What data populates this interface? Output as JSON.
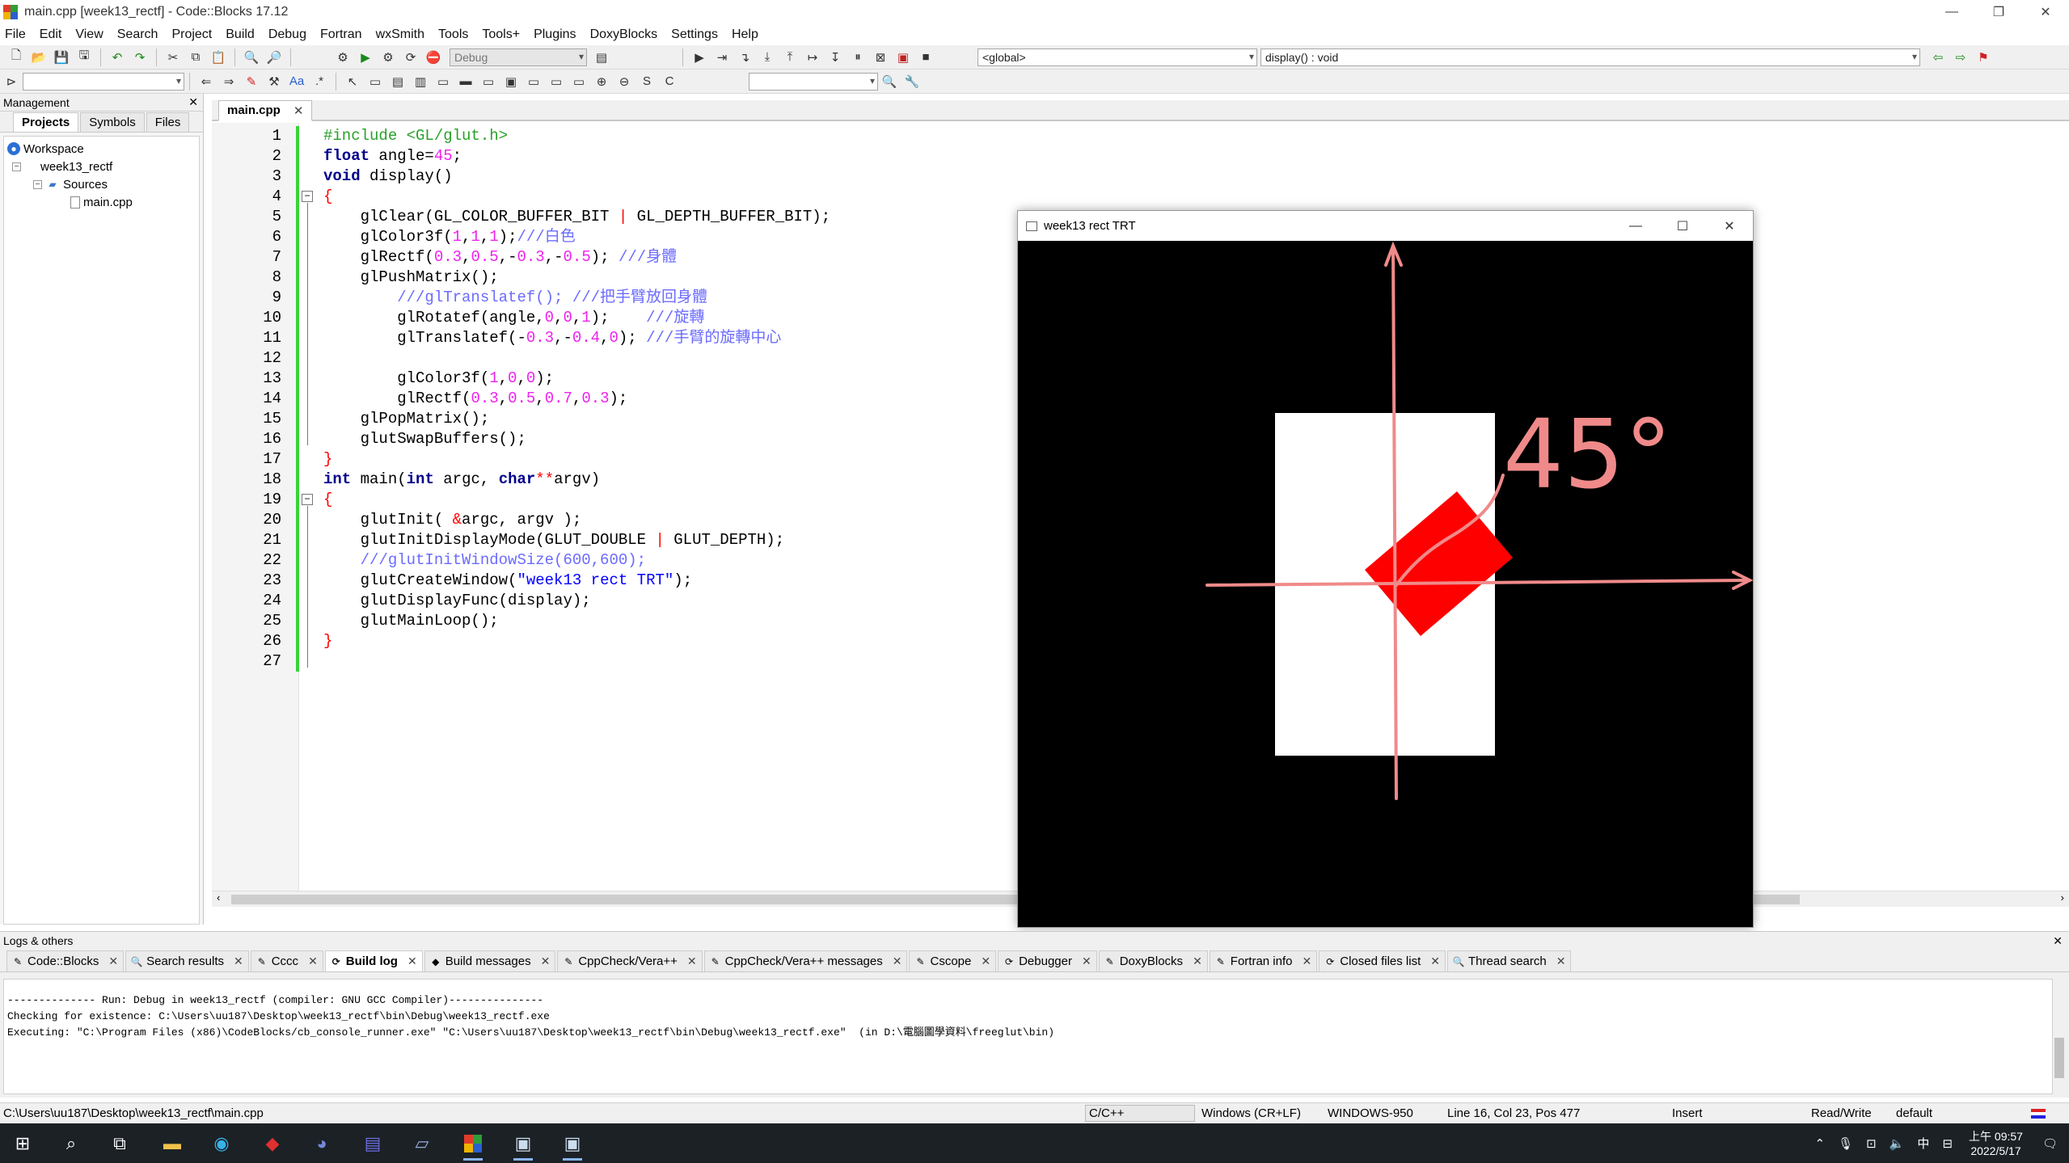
{
  "window": {
    "title": "main.cpp [week13_rectf] - Code::Blocks 17.12",
    "controls": [
      "—",
      "❐",
      "✕"
    ]
  },
  "menu": [
    "File",
    "Edit",
    "View",
    "Search",
    "Project",
    "Build",
    "Debug",
    "Fortran",
    "wxSmith",
    "Tools",
    "Tools+",
    "Plugins",
    "DoxyBlocks",
    "Settings",
    "Help"
  ],
  "toolbar": {
    "build_target": "Debug",
    "scope": "<global>",
    "function": "display() : void"
  },
  "management": {
    "title": "Management",
    "close": "✕",
    "tabs": [
      "Projects",
      "Symbols",
      "Files"
    ],
    "tree": {
      "workspace": "Workspace",
      "project": "week13_rectf",
      "folder": "Sources",
      "file": "main.cpp"
    }
  },
  "editor": {
    "tab_label": "main.cpp",
    "tab_close": "✕",
    "line_numbers": [
      "1",
      "2",
      "3",
      "4",
      "5",
      "6",
      "7",
      "8",
      "9",
      "10",
      "11",
      "12",
      "13",
      "14",
      "15",
      "16",
      "17",
      "18",
      "19",
      "20",
      "21",
      "22",
      "23",
      "24",
      "25",
      "26",
      "27"
    ],
    "code": [
      "#include <GL/glut.h>",
      "float angle=45;",
      "void display()",
      "{",
      "    glClear(GL_COLOR_BUFFER_BIT | GL_DEPTH_BUFFER_BIT);",
      "    glColor3f(1,1,1);///白色",
      "    glRectf(0.3,0.5,-0.3,-0.5); ///身體",
      "    glPushMatrix();",
      "        ///glTranslatef(); ///把手臂放回身體",
      "        glRotatef(angle,0,0,1);    ///旋轉",
      "        glTranslatef(-0.3,-0.4,0); ///手臂的旋轉中心",
      "",
      "        glColor3f(1,0,0);",
      "        glRectf(0.3,0.5,0.7,0.3);",
      "    glPopMatrix();",
      "    glutSwapBuffers();",
      "}",
      "int main(int argc, char**argv)",
      "{",
      "    glutInit( &argc, argv );",
      "    glutInitDisplayMode(GLUT_DOUBLE | GLUT_DEPTH);",
      "    ///glutInitWindowSize(600,600);",
      "    glutCreateWindow(\"week13 rect TRT\");",
      "    glutDisplayFunc(display);",
      "    glutMainLoop();",
      "}",
      ""
    ]
  },
  "glut_window": {
    "title": "week13 rect TRT",
    "controls": [
      "—",
      "☐",
      "✕"
    ],
    "annotation": "45°"
  },
  "logs": {
    "title": "Logs & others",
    "close": "✕",
    "tabs": [
      "Code::Blocks",
      "Search results",
      "Cccc",
      "Build log",
      "Build messages",
      "CppCheck/Vera++",
      "CppCheck/Vera++ messages",
      "Cscope",
      "Debugger",
      "DoxyBlocks",
      "Fortran info",
      "Closed files list",
      "Thread search"
    ],
    "active_tab": "Build log",
    "lines": [
      "-------------- Run: Debug in week13_rectf (compiler: GNU GCC Compiler)---------------",
      "Checking for existence: C:\\Users\\uu187\\Desktop\\week13_rectf\\bin\\Debug\\week13_rectf.exe",
      "Executing: \"C:\\Program Files (x86)\\CodeBlocks/cb_console_runner.exe\" \"C:\\Users\\uu187\\Desktop\\week13_rectf\\bin\\Debug\\week13_rectf.exe\"  (in D:\\電腦圖學資料\\freeglut\\bin)"
    ]
  },
  "status": {
    "path": "C:\\Users\\uu187\\Desktop\\week13_rectf\\main.cpp",
    "lang": "C/C++",
    "eol": "Windows (CR+LF)",
    "encoding": "WINDOWS-950",
    "position": "Line 16, Col 23, Pos 477",
    "mode": "Insert",
    "access": "Read/Write",
    "profile": "default"
  },
  "taskbar": {
    "ime": "中",
    "time": "上午 09:57",
    "date": "2022/5/17"
  }
}
